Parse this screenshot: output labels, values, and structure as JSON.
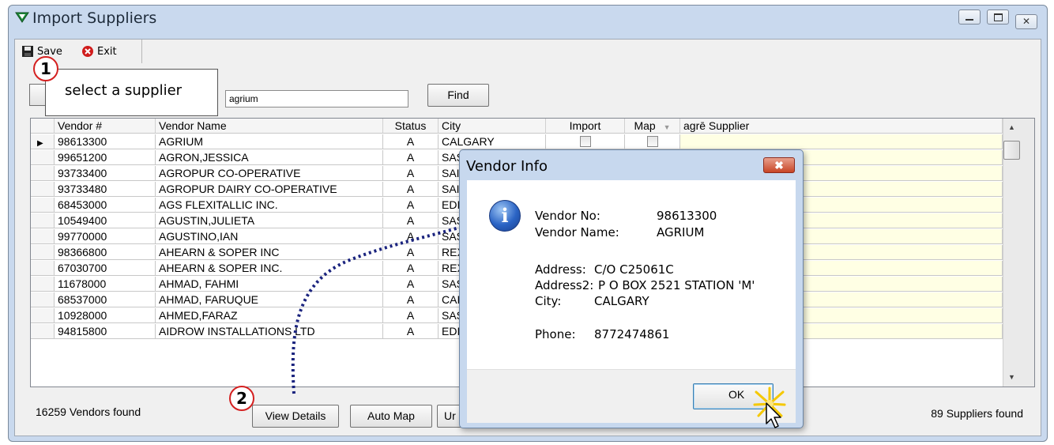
{
  "window": {
    "title": "Import Suppliers"
  },
  "toolbar": {
    "save_label": "Save",
    "exit_label": "Exit"
  },
  "search": {
    "value": "agrium",
    "find_label": "Find"
  },
  "grid": {
    "columns": [
      "Vendor #",
      "Vendor Name",
      "Status",
      "City",
      "Import",
      "Map",
      "agrē Supplier"
    ],
    "rows": [
      {
        "vendor_num": "98613300",
        "name": "AGRIUM",
        "status": "A",
        "city": "CALGARY"
      },
      {
        "vendor_num": "99651200",
        "name": "AGRON,JESSICA",
        "status": "A",
        "city": "SAS"
      },
      {
        "vendor_num": "93733400",
        "name": "AGROPUR CO-OPERATIVE",
        "status": "A",
        "city": "SAI"
      },
      {
        "vendor_num": "93733480",
        "name": "AGROPUR DAIRY CO-OPERATIVE",
        "status": "A",
        "city": "SAI"
      },
      {
        "vendor_num": "68453000",
        "name": "AGS FLEXITALLIC INC.",
        "status": "A",
        "city": "EDI"
      },
      {
        "vendor_num": "10549400",
        "name": "AGUSTIN,JULIETA",
        "status": "A",
        "city": "SAS"
      },
      {
        "vendor_num": "99770000",
        "name": "AGUSTINO,IAN",
        "status": "A",
        "city": "SAS"
      },
      {
        "vendor_num": "98366800",
        "name": "AHEARN & SOPER INC",
        "status": "A",
        "city": "REX"
      },
      {
        "vendor_num": "67030700",
        "name": "AHEARN & SOPER INC.",
        "status": "A",
        "city": "REX"
      },
      {
        "vendor_num": "11678000",
        "name": "AHMAD, FAHMI",
        "status": "A",
        "city": "SAS"
      },
      {
        "vendor_num": "68537000",
        "name": "AHMAD, FARUQUE",
        "status": "A",
        "city": "CAI"
      },
      {
        "vendor_num": "10928000",
        "name": "AHMED,FARAZ",
        "status": "A",
        "city": "SAS"
      },
      {
        "vendor_num": "94815800",
        "name": "AIDROW INSTALLATIONS LTD",
        "status": "A",
        "city": "EDI"
      }
    ]
  },
  "footer": {
    "vendors_found": "16259 Vendors found",
    "suppliers_found": "89 Suppliers found",
    "view_details_label": "View Details",
    "auto_map_label": "Auto Map",
    "third_button_label": "Ur"
  },
  "callouts": {
    "one_number": "1",
    "one_text": "select a supplier",
    "two_number": "2"
  },
  "dialog": {
    "title": "Vendor Info",
    "close_glyph": "✖",
    "vendor_no_label": "Vendor No:",
    "vendor_no": "98613300",
    "vendor_name_label": "Vendor Name:",
    "vendor_name": "AGRIUM",
    "address_label": "Address:",
    "address": "C/O C25061C",
    "address2_label": "Address2:",
    "address2": "P O BOX 2521 STATION 'M'",
    "city_label": "City:",
    "city": "CALGARY",
    "phone_label": "Phone:",
    "phone": "8772474861",
    "ok_label": "OK"
  },
  "colors": {
    "callout_red": "#d42020",
    "dotted_arrow": "#1a237e",
    "supplier_column_bg": "#ffffe4"
  },
  "icons": {
    "app": "green-triangle-icon",
    "save": "floppy-disk-icon",
    "exit": "red-x-circle-icon",
    "info": "info-icon",
    "cursor": "mouse-pointer-icon"
  }
}
